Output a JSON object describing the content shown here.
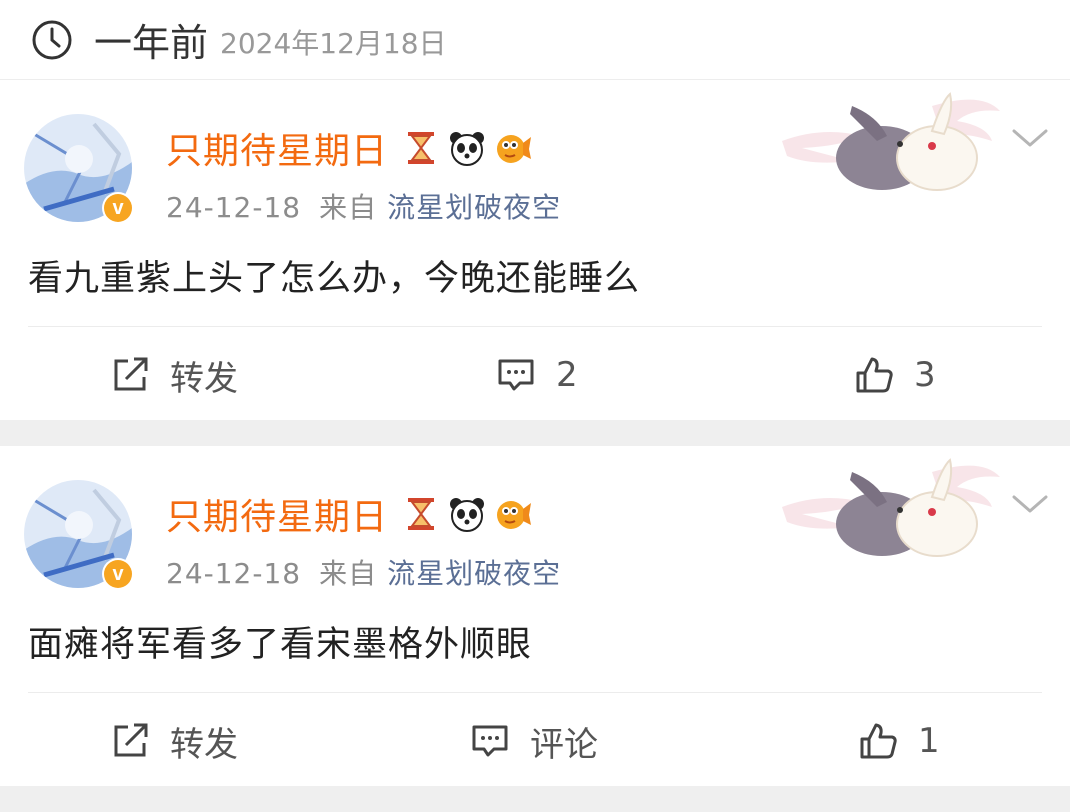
{
  "header": {
    "relative_time": "一年前",
    "date": "2024年12月18日"
  },
  "posts": [
    {
      "username": "只期待星期日",
      "date": "24-12-18",
      "from_label": "来自",
      "source": "流星划破夜空",
      "content": "看九重紫上头了怎么办，今晚还能睡么",
      "repost_label": "转发",
      "comment_label": "2",
      "like_count": "3"
    },
    {
      "username": "只期待星期日",
      "date": "24-12-18",
      "from_label": "来自",
      "source": "流星划破夜空",
      "content": "面瘫将军看多了看宋墨格外顺眼",
      "repost_label": "转发",
      "comment_label": "评论",
      "like_count": "1"
    }
  ],
  "icons": [
    "clock-icon",
    "verified-badge-icon",
    "hourglass-icon",
    "panda-icon",
    "pufferfish-icon",
    "rabbits-decoration",
    "chevron-down-icon",
    "repost-icon",
    "comment-icon",
    "like-icon"
  ],
  "colors": {
    "username": "#f36a10",
    "source": "#5b6f95",
    "badge": "#f7a521",
    "gap": "#efefef"
  }
}
